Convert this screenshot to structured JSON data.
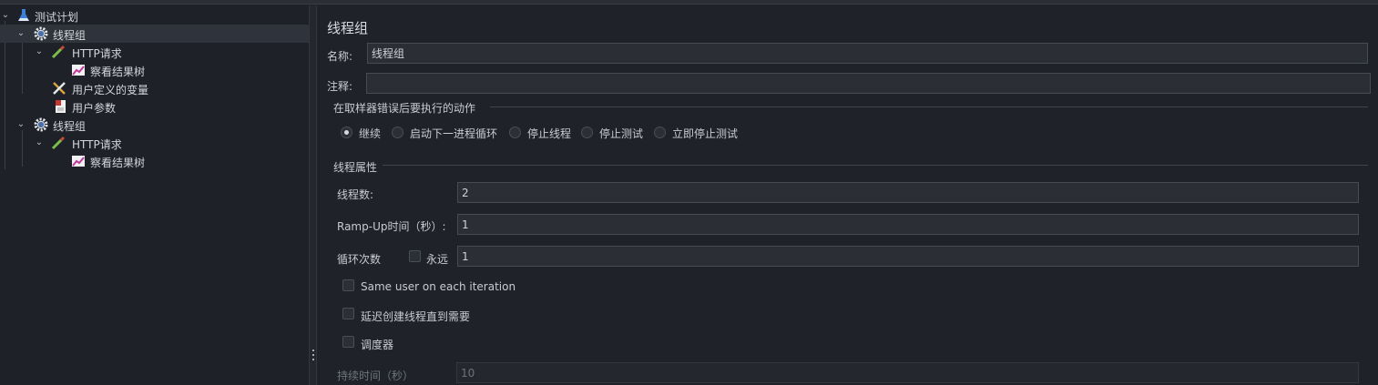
{
  "tree": {
    "items": [
      {
        "label": "测试计划",
        "icon": "flask-icon"
      },
      {
        "label": "线程组",
        "icon": "gear-icon"
      },
      {
        "label": "HTTP请求",
        "icon": "pipette-icon"
      },
      {
        "label": "察看结果树",
        "icon": "chart-icon"
      },
      {
        "label": "用户定义的变量",
        "icon": "tools-icon"
      },
      {
        "label": "用户参数",
        "icon": "document-icon"
      },
      {
        "label": "线程组",
        "icon": "gear-icon"
      },
      {
        "label": "HTTP请求",
        "icon": "pipette-icon"
      },
      {
        "label": "察看结果树",
        "icon": "chart-icon"
      }
    ]
  },
  "panel": {
    "title": "线程组",
    "name_label": "名称:",
    "name_value": "线程组",
    "comment_label": "注释:",
    "comment_value": "",
    "on_error": {
      "section_label": "在取样器错误后要执行的动作",
      "options": [
        "继续",
        "启动下一进程循环",
        "停止线程",
        "停止测试",
        "立即停止测试"
      ],
      "selected": "继续"
    },
    "thread_props": {
      "section_label": "线程属性",
      "threads_label": "线程数:",
      "threads_value": "2",
      "rampup_label": "Ramp-Up时间（秒）:",
      "rampup_value": "1",
      "loop_label": "循环次数",
      "forever_label": "永远",
      "forever_checked": false,
      "loop_value": "1",
      "same_user_label": "Same user on each iteration",
      "same_user_checked": false,
      "delay_label": "延迟创建线程直到需要",
      "delay_checked": false,
      "scheduler_label": "调度器",
      "scheduler_checked": false,
      "duration_label": "持续时间（秒）",
      "duration_value": "10"
    }
  },
  "colors": {
    "background": "#1f2229",
    "tree_selected": "#2f333b",
    "field_bg": "#2b2e35",
    "text": "#c8ccd2"
  }
}
